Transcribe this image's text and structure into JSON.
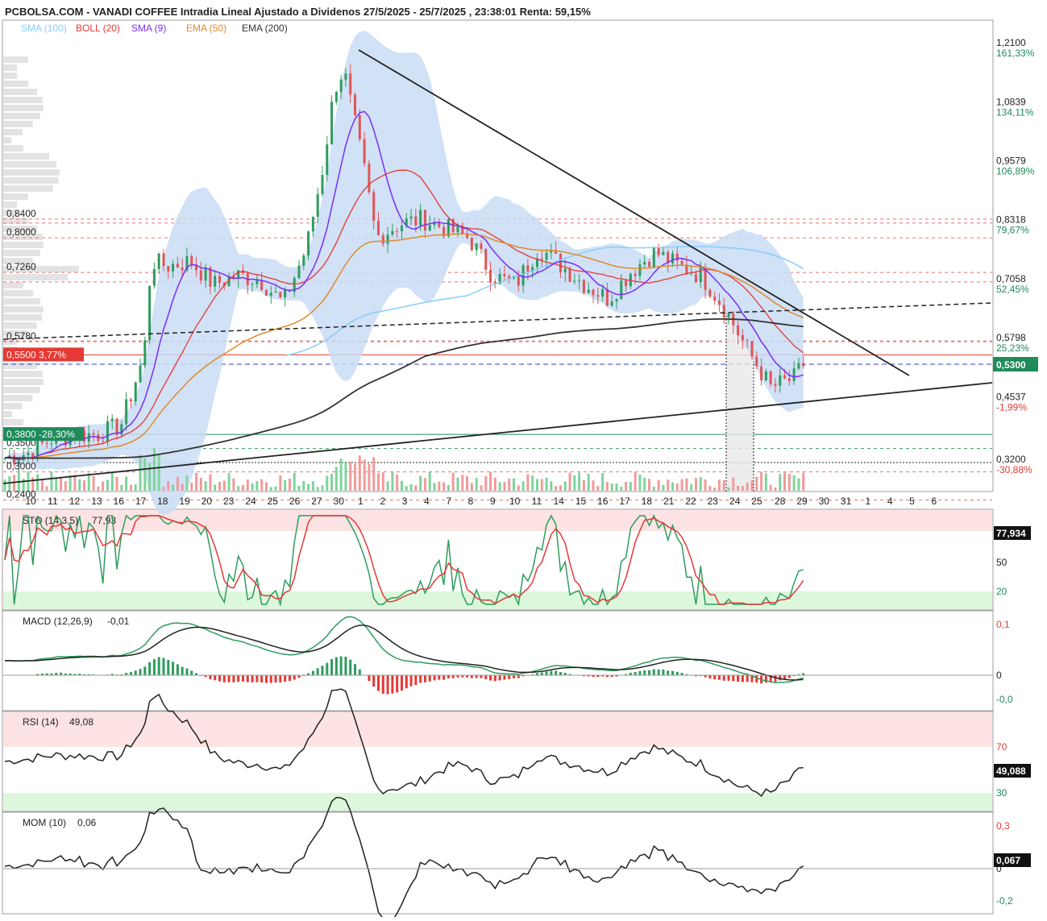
{
  "header": {
    "title": "PCBOLSA.COM - VANADI COFFEE Intradia Lineal Ajustado a Dividenos 27/5/2025 - 25/7/2025 , 23:38:01 Renta: 59,15%",
    "legend": [
      {
        "label": "SMA (100)",
        "color": "#87cefa"
      },
      {
        "label": "BOLL (20)",
        "color": "#e53935"
      },
      {
        "label": "SMA (9)",
        "color": "#7b2ff7"
      },
      {
        "label": "EMA (50)",
        "color": "#e08a2c"
      },
      {
        "label": "EMA (200)",
        "color": "#333333"
      }
    ]
  },
  "price_axis": [
    {
      "price": 1.21,
      "label": "1,2100",
      "pct": "161,33%"
    },
    {
      "price": 1.0839,
      "label": "1,0839",
      "pct": "134,11%"
    },
    {
      "price": 0.9579,
      "label": "0,9579",
      "pct": "106,89%"
    },
    {
      "price": 0.8318,
      "label": "0,8318",
      "pct": "79,67%"
    },
    {
      "price": 0.7058,
      "label": "0,7058",
      "pct": "52,45%"
    },
    {
      "price": 0.5798,
      "label": "0,5798",
      "pct": "25,23%"
    },
    {
      "price": 0.4537,
      "label": "0,4537",
      "pct": "-1,99%"
    },
    {
      "price": 0.32,
      "label": "0,3200",
      "pct": "-30,88%"
    }
  ],
  "current_price": {
    "label": "0,5300",
    "value": 0.53,
    "color": "#1f8a5a"
  },
  "left_levels": [
    {
      "price": 0.84,
      "label": "0,8400",
      "line_color": "#e57373",
      "dashed": true
    },
    {
      "price": 0.8,
      "label": "0,8000",
      "line_color": "#e57373",
      "dashed": true
    },
    {
      "price": 0.726,
      "label": "0,7260",
      "line_color": "#e57373",
      "dashed": true
    },
    {
      "price": 0.578,
      "label": "0,5780",
      "line_color": "#e57373",
      "dashed": true
    },
    {
      "price": 0.35,
      "label": "0,3500",
      "line_color": "#2e9c5e",
      "dashed": true
    },
    {
      "price": 0.3,
      "label": "0,3000",
      "line_color": "#e57373",
      "dashed": true
    },
    {
      "price": 0.24,
      "label": "0,2400",
      "line_color": "#e57373",
      "dashed": true
    }
  ],
  "box_labels": [
    {
      "price": 0.55,
      "label": "0,5500",
      "pct": "3,77%",
      "color": "#e53935"
    },
    {
      "price": 0.38,
      "label": "0,3800",
      "pct": "-28,30%",
      "color": "#1f8a5a"
    }
  ],
  "x_axis": [
    "10",
    "11",
    "12",
    "13",
    "16",
    "17",
    "18",
    "19",
    "20",
    "23",
    "24",
    "25",
    "26",
    "27",
    "30",
    "1",
    "2",
    "3",
    "4",
    "7",
    "8",
    "9",
    "10",
    "11",
    "14",
    "15",
    "16",
    "17",
    "18",
    "21",
    "22",
    "23",
    "24",
    "25",
    "28",
    "29",
    "30",
    "31",
    "1",
    "4",
    "5",
    "6"
  ],
  "panels": {
    "sto": {
      "title": "STO (14,3,5)",
      "value": "77,93",
      "badge": "77,934",
      "levels": [
        "50",
        "20"
      ]
    },
    "macd": {
      "title": "MACD (12,26,9)",
      "value": "-0,01",
      "levels": [
        "0,1",
        "0",
        "-0,0"
      ]
    },
    "rsi": {
      "title": "RSI (14)",
      "value": "49,08",
      "badge": "49,088",
      "levels": [
        "70",
        "30"
      ]
    },
    "mom": {
      "title": "MOM (10)",
      "value": "0,06",
      "badge": "0,067",
      "levels": [
        "0,3",
        "0",
        "-0,2"
      ]
    }
  },
  "chart_data": {
    "type": "line",
    "price_range": [
      0.2,
      1.21
    ],
    "sessions": 35,
    "close_series_key": [
      {
        "s": 0.0,
        "v": 0.33
      },
      {
        "s": 1.0,
        "v": 0.34
      },
      {
        "s": 2.0,
        "v": 0.37
      },
      {
        "s": 3.0,
        "v": 0.38
      },
      {
        "s": 4.0,
        "v": 0.38
      },
      {
        "s": 5.0,
        "v": 0.4
      },
      {
        "s": 6.0,
        "v": 0.55
      },
      {
        "s": 6.3,
        "v": 0.75
      },
      {
        "s": 7.0,
        "v": 0.74
      },
      {
        "s": 8.0,
        "v": 0.75
      },
      {
        "s": 9.0,
        "v": 0.7
      },
      {
        "s": 10.0,
        "v": 0.72
      },
      {
        "s": 11.0,
        "v": 0.71
      },
      {
        "s": 12.0,
        "v": 0.66
      },
      {
        "s": 13.0,
        "v": 0.78
      },
      {
        "s": 13.7,
        "v": 0.95
      },
      {
        "s": 14.2,
        "v": 1.12
      },
      {
        "s": 14.6,
        "v": 1.16
      },
      {
        "s": 15.5,
        "v": 0.94
      },
      {
        "s": 16.0,
        "v": 0.8
      },
      {
        "s": 17.0,
        "v": 0.83
      },
      {
        "s": 18.0,
        "v": 0.84
      },
      {
        "s": 19.0,
        "v": 0.82
      },
      {
        "s": 20.0,
        "v": 0.8
      },
      {
        "s": 21.0,
        "v": 0.72
      },
      {
        "s": 22.0,
        "v": 0.7
      },
      {
        "s": 23.0,
        "v": 0.78
      },
      {
        "s": 24.0,
        "v": 0.74
      },
      {
        "s": 25.0,
        "v": 0.7
      },
      {
        "s": 26.0,
        "v": 0.67
      },
      {
        "s": 27.0,
        "v": 0.73
      },
      {
        "s": 28.0,
        "v": 0.77
      },
      {
        "s": 29.0,
        "v": 0.74
      },
      {
        "s": 30.0,
        "v": 0.72
      },
      {
        "s": 31.0,
        "v": 0.65
      },
      {
        "s": 32.0,
        "v": 0.56
      },
      {
        "s": 33.0,
        "v": 0.48
      },
      {
        "s": 34.0,
        "v": 0.5
      },
      {
        "s": 34.4,
        "v": 0.53
      }
    ]
  }
}
